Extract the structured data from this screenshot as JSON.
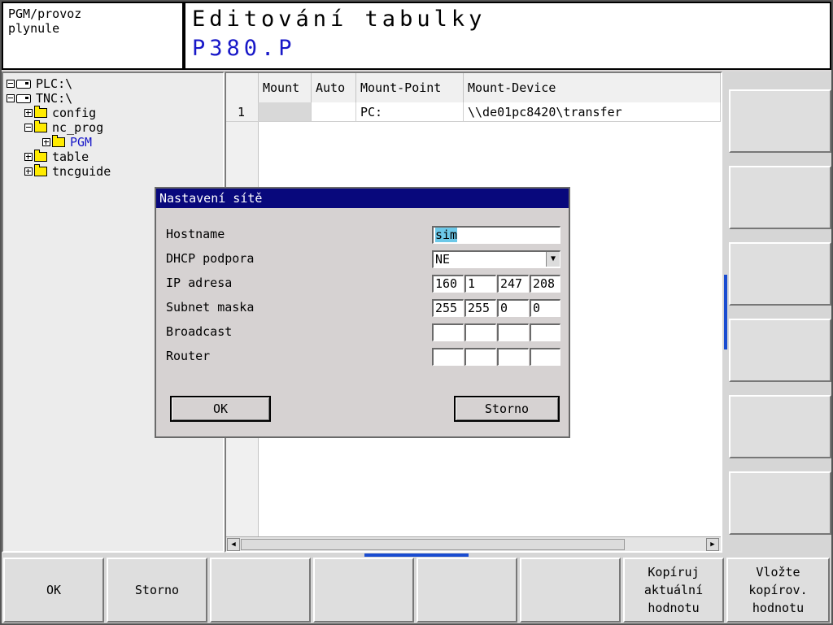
{
  "header": {
    "mode_line1": "PGM/provoz",
    "mode_line2": "plynule",
    "title": "Editování tabulky",
    "filename": "P380.P"
  },
  "tree": [
    {
      "label": "PLC:\\",
      "icon": "drive-icon"
    },
    {
      "label": "TNC:\\",
      "icon": "drive-icon"
    },
    {
      "label": "config",
      "icon": "folder-icon"
    },
    {
      "label": "nc_prog",
      "icon": "folder-icon"
    },
    {
      "label": "PGM",
      "icon": "folder-icon",
      "selected": true
    },
    {
      "label": "table",
      "icon": "folder-icon"
    },
    {
      "label": "tncguide",
      "icon": "folder-icon"
    }
  ],
  "table": {
    "columns": [
      "Mount",
      "Auto",
      "Mount-Point",
      "Mount-Device"
    ],
    "rows": [
      {
        "index": "1",
        "mount": "",
        "auto": "",
        "mount_point": "PC:",
        "mount_device": "\\\\de01pc8420\\transfer"
      }
    ]
  },
  "dialog": {
    "title": "Nastavení sítě",
    "hostname_label": "Hostname",
    "hostname_value": "sim",
    "dhcp_label": "DHCP podpora",
    "dhcp_value": "NE",
    "ip_label": "IP adresa",
    "ip": [
      "160",
      "1",
      "247",
      "208"
    ],
    "subnet_label": "Subnet maska",
    "subnet": [
      "255",
      "255",
      "0",
      "0"
    ],
    "broadcast_label": "Broadcast",
    "broadcast": [
      "",
      "",
      "",
      ""
    ],
    "router_label": "Router",
    "router": [
      "",
      "",
      "",
      ""
    ],
    "ok_label": "OK",
    "cancel_label": "Storno"
  },
  "softkeys": {
    "ok": "OK",
    "cancel": "Storno",
    "copy": "Kopíruj\naktuální\nhodnotu",
    "paste": "Vložte\nkopírov.\nhodnotu"
  },
  "colors": {
    "title_blue": "#1818c8",
    "dialog_title_bg": "#08087c",
    "highlight": "#6cc8e8",
    "indicator_blue": "#1a4cd0"
  }
}
